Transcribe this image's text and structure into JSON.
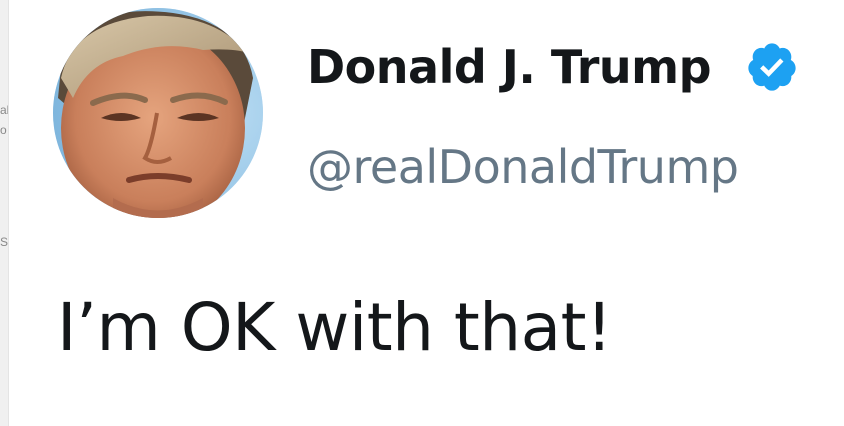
{
  "side_text": {
    "line1": "al",
    "line2": "o",
    "line3": "S"
  },
  "profile": {
    "display_name": "Donald J. Trump",
    "handle": "@realDonaldTrump",
    "verified": true,
    "avatar_icon": "avatar-photo",
    "verified_icon": "verified-badge-icon",
    "verified_color": "#1da1f2"
  },
  "tweet": {
    "text": "I’m OK with that!"
  },
  "colors": {
    "name": "#14171a",
    "handle": "#657786",
    "text": "#14171a",
    "background": "#ffffff"
  }
}
